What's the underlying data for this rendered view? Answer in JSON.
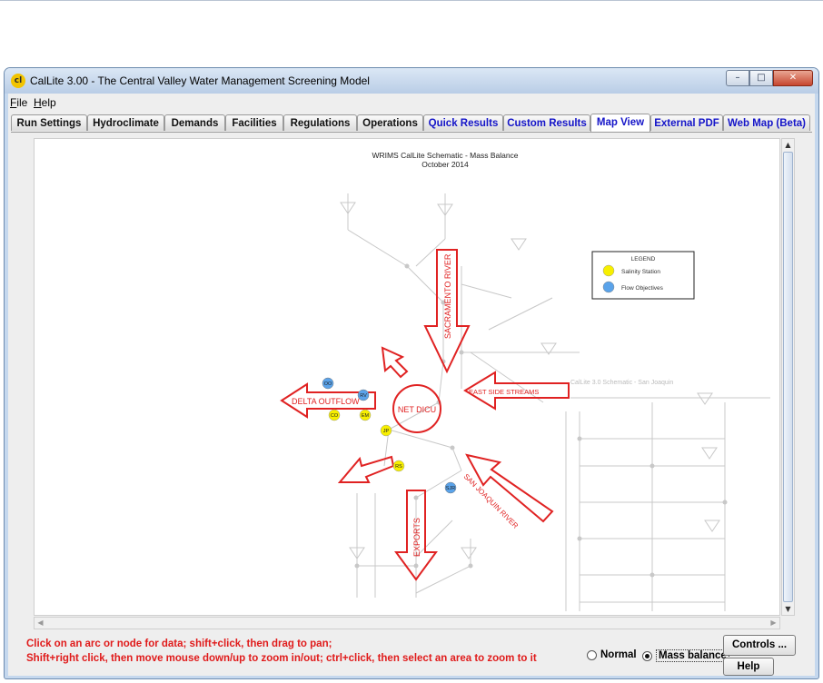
{
  "window": {
    "title": "CalLite 3.00 -  The Central Valley Water Management Screening Model",
    "app_icon_text": "cl",
    "controls": {
      "minimize": "–",
      "maximize": "□",
      "close": "✕"
    }
  },
  "menu": [
    {
      "label": "File",
      "mnemonic": "F"
    },
    {
      "label": "Help",
      "mnemonic": "H"
    }
  ],
  "tabs": [
    {
      "label": "Run Settings",
      "color": "#111111"
    },
    {
      "label": "Hydroclimate",
      "color": "#111111"
    },
    {
      "label": "Demands",
      "color": "#111111"
    },
    {
      "label": "Facilities",
      "color": "#111111"
    },
    {
      "label": "Regulations",
      "color": "#111111"
    },
    {
      "label": "Operations",
      "color": "#111111"
    },
    {
      "label": "Quick Results",
      "color": "#1414c8"
    },
    {
      "label": "Custom Results",
      "color": "#1414c8"
    },
    {
      "label": "Map View",
      "color": "#1414c8",
      "active": true
    },
    {
      "label": "External PDF",
      "color": "#1414c8"
    },
    {
      "label": "Web Map (Beta)",
      "color": "#1414c8"
    }
  ],
  "map": {
    "title": "WRIMS CalLite Schematic - Mass Balance",
    "subtitle": "October 2014",
    "legend": {
      "title": "LEGEND",
      "items": [
        {
          "label": "Salinity Station",
          "color": "#f7ef00"
        },
        {
          "label": "Flow Objectives",
          "color": "#5aa3ea"
        }
      ]
    },
    "secondary_title": "CalLite 3.0 Schematic - San Joaquin",
    "arrows": {
      "sacramento": "SACRAMENTO RIVER",
      "delta_outflow": "DELTA OUTFLOW",
      "east_side": "EAST SIDE STREAMS",
      "san_joaquin": "SAN JOAQUIN RIVER",
      "exports": "EXPORTS",
      "center": "NET DICU"
    },
    "stations": [
      {
        "label": "OO",
        "color": "#5aa3ea"
      },
      {
        "label": "RV",
        "color": "#5aa3ea"
      },
      {
        "label": "CO",
        "color": "#f7ef00"
      },
      {
        "label": "EM",
        "color": "#f7ef00"
      },
      {
        "label": "JP",
        "color": "#f7ef00"
      },
      {
        "label": "RS",
        "color": "#f7ef00"
      },
      {
        "label": "SJR",
        "color": "#5aa3ea"
      }
    ]
  },
  "status": {
    "line1": "Click on an arc or node for data; shift+click, then drag to pan;",
    "line2": "Shift+right click, then move mouse down/up to zoom in/out; ctrl+click, then select an area to zoom to it"
  },
  "view_mode": {
    "options": [
      {
        "label": "Normal",
        "selected": false
      },
      {
        "label": "Mass balance",
        "selected": true
      }
    ]
  },
  "buttons": {
    "controls": "Controls ...",
    "help": "Help"
  }
}
